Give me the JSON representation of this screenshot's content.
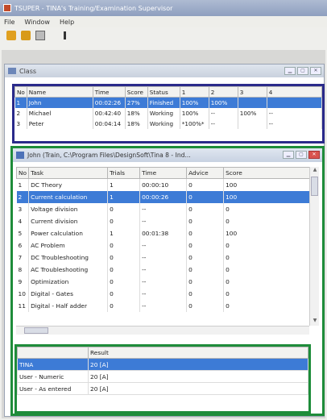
{
  "titlebar": {
    "title": "TSUPER - TINA's Training/Examination Supervisor"
  },
  "menu": [
    "File",
    "Window",
    "Help"
  ],
  "class_window": {
    "title": "Class",
    "buttons": [
      "▁",
      "▢",
      "✕"
    ]
  },
  "students": {
    "columns": [
      "No",
      "Name",
      "Time",
      "Score",
      "Status",
      "1",
      "2",
      "3",
      "4"
    ],
    "rows": [
      {
        "no": "1",
        "name": "John",
        "time": "00:02:26",
        "score": "27%",
        "status": "Finished",
        "c1": "100%",
        "c2": "100%",
        "c3": "",
        "c4": ""
      },
      {
        "no": "2",
        "name": "Michael",
        "time": "00:42:40",
        "score": "18%",
        "status": "Working",
        "c1": "100%",
        "c2": "--",
        "c3": "100%",
        "c4": "--"
      },
      {
        "no": "3",
        "name": "Peter",
        "time": "00:04:14",
        "score": "18%",
        "status": "Working",
        "c1": "*100%*",
        "c2": "--",
        "c3": "",
        "c4": "--"
      }
    ]
  },
  "task_window": {
    "title": "John (Train, C:\\Program Files\\DesignSoft\\Tina 8 - Ind...",
    "buttons": [
      "▁",
      "▢",
      "✕"
    ],
    "columns": [
      "No",
      "Task",
      "Trials",
      "Time",
      "Advice",
      "Score"
    ],
    "rows": [
      {
        "no": "1",
        "task": "DC Theory",
        "trials": "1",
        "time": "00:00:10",
        "advice": "0",
        "score": "100"
      },
      {
        "no": "2",
        "task": "Current calculation",
        "trials": "1",
        "time": "00:00:26",
        "advice": "0",
        "score": "100"
      },
      {
        "no": "3",
        "task": "Voltage division",
        "trials": "0",
        "time": "--",
        "advice": "0",
        "score": "0"
      },
      {
        "no": "4",
        "task": "Current division",
        "trials": "0",
        "time": "--",
        "advice": "0",
        "score": "0"
      },
      {
        "no": "5",
        "task": "Power calculation",
        "trials": "1",
        "time": "00:01:38",
        "advice": "0",
        "score": "100"
      },
      {
        "no": "6",
        "task": "AC Problem",
        "trials": "0",
        "time": "--",
        "advice": "0",
        "score": "0"
      },
      {
        "no": "7",
        "task": "DC Troubleshooting",
        "trials": "0",
        "time": "--",
        "advice": "0",
        "score": "0"
      },
      {
        "no": "8",
        "task": "AC Troubleshooting",
        "trials": "0",
        "time": "--",
        "advice": "0",
        "score": "0"
      },
      {
        "no": "9",
        "task": "Optimization",
        "trials": "0",
        "time": "--",
        "advice": "0",
        "score": "0"
      },
      {
        "no": "10",
        "task": "Digital - Gates",
        "trials": "0",
        "time": "--",
        "advice": "0",
        "score": "0"
      },
      {
        "no": "11",
        "task": "Digital - Half adder",
        "trials": "0",
        "time": "--",
        "advice": "0",
        "score": "0"
      }
    ],
    "selected_row": 1
  },
  "results": {
    "columns": [
      "",
      "Result"
    ],
    "rows": [
      {
        "label": "TINA",
        "value": "20 [A]"
      },
      {
        "label": "User - Numeric",
        "value": "20 [A]"
      },
      {
        "label": "User - As entered",
        "value": "20 [A]"
      }
    ],
    "selected_row": 0
  },
  "colors": {
    "selection": "#3d7bd6",
    "class_frame": "#2a2a8a",
    "task_frame": "#1e8c3a"
  }
}
